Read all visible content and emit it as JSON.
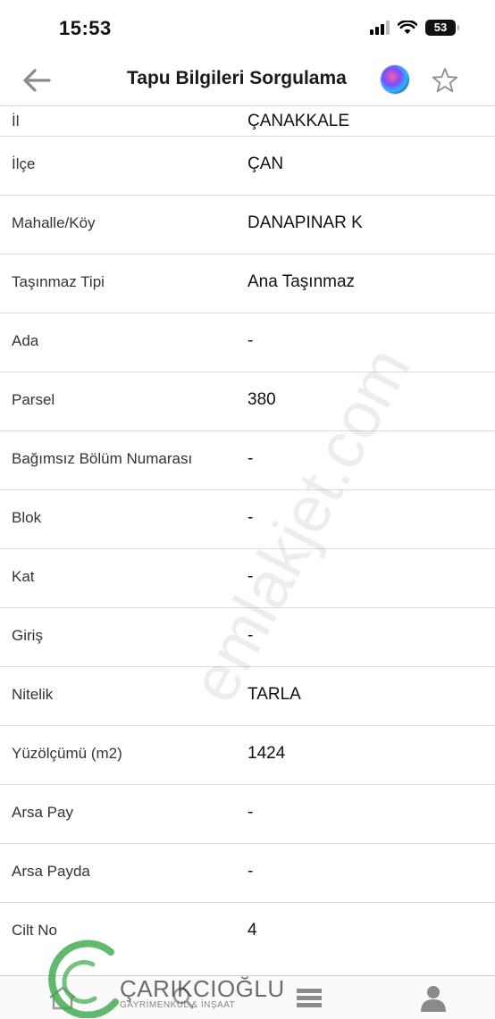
{
  "status_bar": {
    "time": "15:53",
    "battery": "53"
  },
  "nav": {
    "title": "Tapu Bilgileri Sorgulama"
  },
  "rows": [
    {
      "label": "İl",
      "value": "ÇANAKKALE"
    },
    {
      "label": "İlçe",
      "value": "ÇAN"
    },
    {
      "label": "Mahalle/Köy",
      "value": "DANAPINAR K"
    },
    {
      "label": "Taşınmaz Tipi",
      "value": "Ana Taşınmaz"
    },
    {
      "label": "Ada",
      "value": "-"
    },
    {
      "label": "Parsel",
      "value": "380"
    },
    {
      "label": "Bağımsız Bölüm Numarası",
      "value": "-"
    },
    {
      "label": "Blok",
      "value": "-"
    },
    {
      "label": "Kat",
      "value": "-"
    },
    {
      "label": "Giriş",
      "value": "-"
    },
    {
      "label": "Nitelik",
      "value": "TARLA"
    },
    {
      "label": "Yüzölçümü (m2)",
      "value": "1424"
    },
    {
      "label": "Arsa Pay",
      "value": "-"
    },
    {
      "label": "Arsa Payda",
      "value": "-"
    },
    {
      "label": "Cilt No",
      "value": "4"
    }
  ],
  "watermark": "emlakjet.com",
  "logo": {
    "name": "ÇARIKCIOĞLU",
    "subtitle": "GAYRİMENKUL & İNŞAAT"
  },
  "colors": {
    "logo_green": "#3aa84a",
    "divider": "#dcdcdc",
    "text": "#111111"
  }
}
